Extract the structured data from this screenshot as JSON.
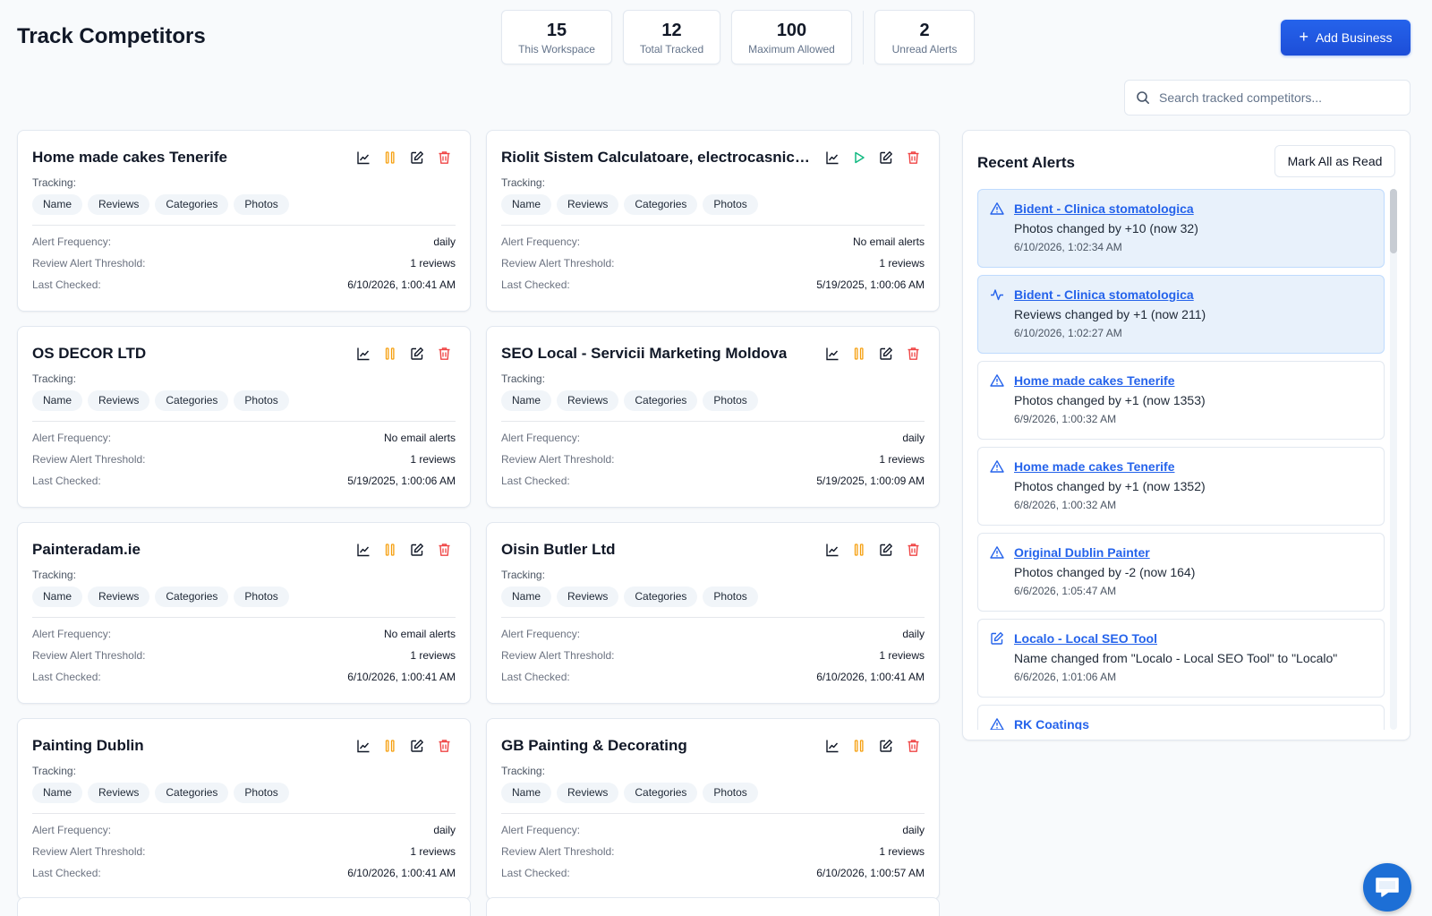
{
  "page": {
    "title": "Track Competitors"
  },
  "stats": [
    {
      "value": "15",
      "label": "This Workspace"
    },
    {
      "value": "12",
      "label": "Total Tracked"
    },
    {
      "value": "100",
      "label": "Maximum Allowed"
    },
    {
      "value": "2",
      "label": "Unread Alerts"
    }
  ],
  "add_button": {
    "label": "Add Business",
    "icon": "plus-icon"
  },
  "search": {
    "placeholder": "Search tracked competitors...",
    "value": ""
  },
  "card_labels": {
    "tracking": "Tracking:",
    "alert_frequency": "Alert Frequency:",
    "review_threshold": "Review Alert Threshold:",
    "last_checked": "Last Checked:"
  },
  "competitors": [
    {
      "name": "Home made cakes Tenerife",
      "status": "active",
      "tags": [
        "Name",
        "Reviews",
        "Categories",
        "Photos"
      ],
      "alert_frequency": "daily",
      "review_threshold": "1 reviews",
      "last_checked": "6/10/2026, 1:00:41 AM"
    },
    {
      "name": "Riolit Sistem Calculatoare, electrocasnice Chisinau",
      "status": "paused",
      "tags": [
        "Name",
        "Reviews",
        "Categories",
        "Photos"
      ],
      "alert_frequency": "No email alerts",
      "review_threshold": "1 reviews",
      "last_checked": "5/19/2025, 1:00:06 AM"
    },
    {
      "name": "OS DECOR LTD",
      "status": "active",
      "tags": [
        "Name",
        "Reviews",
        "Categories",
        "Photos"
      ],
      "alert_frequency": "No email alerts",
      "review_threshold": "1 reviews",
      "last_checked": "5/19/2025, 1:00:06 AM"
    },
    {
      "name": "SEO Local - Servicii Marketing Moldova",
      "status": "active",
      "tags": [
        "Name",
        "Reviews",
        "Categories",
        "Photos"
      ],
      "alert_frequency": "daily",
      "review_threshold": "1 reviews",
      "last_checked": "5/19/2025, 1:00:09 AM"
    },
    {
      "name": "Painteradam.ie",
      "status": "active",
      "tags": [
        "Name",
        "Reviews",
        "Categories",
        "Photos"
      ],
      "alert_frequency": "No email alerts",
      "review_threshold": "1 reviews",
      "last_checked": "6/10/2026, 1:00:41 AM"
    },
    {
      "name": "Oisin Butler Ltd",
      "status": "active",
      "tags": [
        "Name",
        "Reviews",
        "Categories",
        "Photos"
      ],
      "alert_frequency": "daily",
      "review_threshold": "1 reviews",
      "last_checked": "6/10/2026, 1:00:41 AM"
    },
    {
      "name": "Painting Dublin",
      "status": "active",
      "tags": [
        "Name",
        "Reviews",
        "Categories",
        "Photos"
      ],
      "alert_frequency": "daily",
      "review_threshold": "1 reviews",
      "last_checked": "6/10/2026, 1:00:41 AM"
    },
    {
      "name": "GB Painting & Decorating",
      "status": "active",
      "tags": [
        "Name",
        "Reviews",
        "Categories",
        "Photos"
      ],
      "alert_frequency": "daily",
      "review_threshold": "1 reviews",
      "last_checked": "6/10/2026, 1:00:57 AM"
    }
  ],
  "alerts_panel": {
    "title": "Recent Alerts",
    "mark_all_label": "Mark All as Read",
    "alerts": [
      {
        "title": "Bident - Clinica stomatologica",
        "message": "Photos changed by +10 (now 32)",
        "time": "6/10/2026, 1:02:34 AM",
        "icon": "warning-triangle-icon",
        "unread": true
      },
      {
        "title": "Bident - Clinica stomatologica",
        "message": "Reviews changed by +1 (now 211)",
        "time": "6/10/2026, 1:02:27 AM",
        "icon": "activity-pulse-icon",
        "unread": true
      },
      {
        "title": "Home made cakes Tenerife",
        "message": "Photos changed by +1 (now 1353)",
        "time": "6/9/2026, 1:00:32 AM",
        "icon": "warning-triangle-icon",
        "unread": false
      },
      {
        "title": "Home made cakes Tenerife",
        "message": "Photos changed by +1 (now 1352)",
        "time": "6/8/2026, 1:00:32 AM",
        "icon": "warning-triangle-icon",
        "unread": false
      },
      {
        "title": "Original Dublin Painter",
        "message": "Photos changed by -2 (now 164)",
        "time": "6/6/2026, 1:05:47 AM",
        "icon": "warning-triangle-icon",
        "unread": false
      },
      {
        "title": "Localo - Local SEO Tool",
        "message": "Name changed from \"Localo - Local SEO Tool\" to \"Localo\"",
        "time": "6/6/2026, 1:01:06 AM",
        "icon": "edit-icon",
        "unread": false
      },
      {
        "title": "RK Coatings",
        "message": "",
        "time": "",
        "icon": "warning-triangle-icon",
        "unread": false
      }
    ]
  },
  "colors": {
    "accent": "#2563eb",
    "pause": "#f59e0b",
    "play": "#10b981",
    "delete": "#ef4444",
    "unread_bg": "#e8f1fb"
  }
}
